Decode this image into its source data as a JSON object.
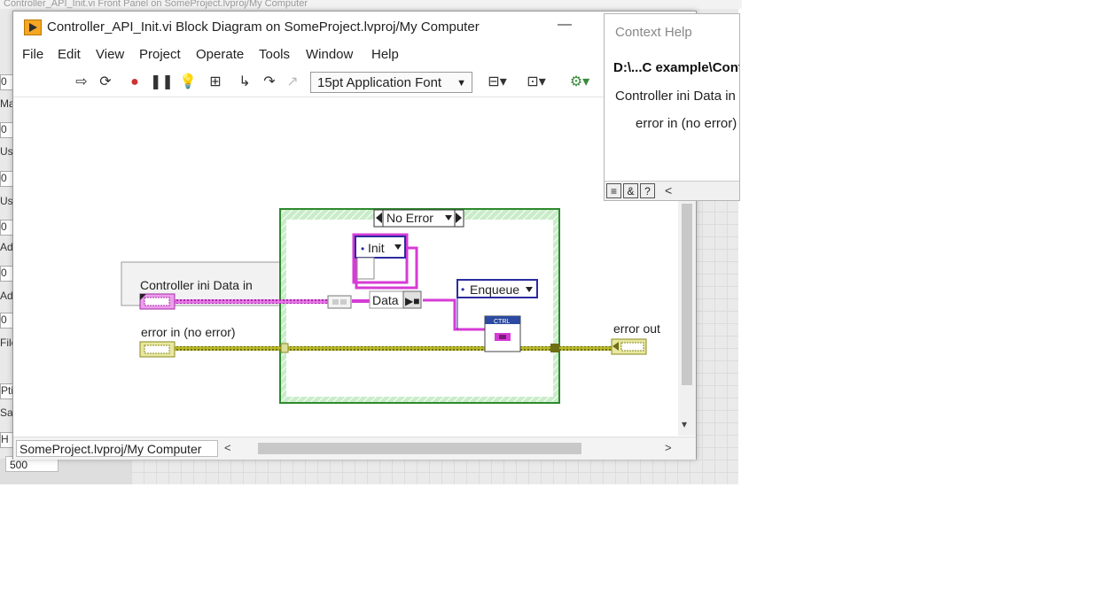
{
  "background": {
    "title": "Controller_API_Init.vi Front Panel on SomeProject.lvproj/My Computer",
    "left_labels": [
      "0",
      "Ma",
      "0",
      "Use",
      "0",
      "Use",
      "0",
      "Add",
      "0",
      "Add",
      "0",
      "File",
      "Pti",
      "Sag",
      "H"
    ],
    "numeric_value": "500"
  },
  "window": {
    "title": "Controller_API_Init.vi Block Diagram on SomeProject.lvproj/My Computer",
    "minimize_glyph": "—"
  },
  "menu": [
    "File",
    "Edit",
    "View",
    "Project",
    "Operate",
    "Tools",
    "Window",
    "Help"
  ],
  "toolbar": {
    "font_select": "15pt Application Font",
    "icons": [
      "run-arrow-icon",
      "run-continuously-icon",
      "abort-icon",
      "pause-icon",
      "highlight-execution-icon",
      "retain-wire-values-icon",
      "step-into-icon",
      "step-over-icon",
      "step-out-icon",
      "align-objects-icon",
      "distribute-objects-icon",
      "reorder-icon"
    ]
  },
  "diagram": {
    "case_selector": "No Error",
    "init_constant": "Init",
    "data_label": "Data",
    "enqueue_label": "Enqueue",
    "ctrl_label": "CTRL",
    "controller_ini_label": "Controller ini Data in",
    "error_in_label": "error in (no error)",
    "error_out_label": "error out"
  },
  "statusbar": {
    "path": "SomeProject.lvproj/My Computer"
  },
  "context_help": {
    "title": "Context Help",
    "path": "D:\\...C example\\Cont",
    "line1": "Controller ini Data in",
    "line2": "error in (no error)",
    "collapse_glyph": "<"
  },
  "colors": {
    "cluster_wire": "#d63bd6",
    "error_wire": "#b9b92a",
    "case_border": "#2d8a2d",
    "enum_border": "#2b2b9e"
  }
}
